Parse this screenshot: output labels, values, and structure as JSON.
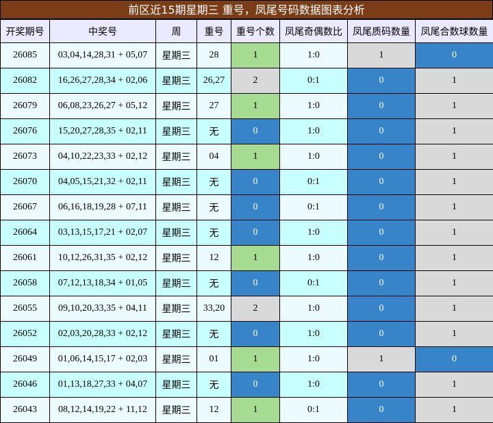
{
  "title": "前区近15期星期三 重号，凤尾号码数据图表分析",
  "headers": [
    "开奖期号",
    "中奖号",
    "周",
    "重号",
    "重号个数",
    "凤尾奇偶数比",
    "凤尾质码数量",
    "凤尾合数球数量"
  ],
  "colors": {
    "title_bg": "#7a3d16",
    "header_bg": "#eaeaff",
    "row_odd": "#ebfbff",
    "row_even": "#c8ffff",
    "green": "#a6dc92",
    "blue": "#3784c8",
    "gray": "#d9d9d9"
  },
  "rows": [
    {
      "issue": "26085",
      "numbers": "03,04,14,28,31 + 05,07",
      "week": "星期三",
      "repeat": "28",
      "repeat_count": "1",
      "ratio": "1:0",
      "prime": "1",
      "composite": "0"
    },
    {
      "issue": "26082",
      "numbers": "16,26,27,28,34 + 02,06",
      "week": "星期三",
      "repeat": "26,27",
      "repeat_count": "2",
      "ratio": "0:1",
      "prime": "0",
      "composite": "1"
    },
    {
      "issue": "26079",
      "numbers": "06,08,23,26,27 + 05,12",
      "week": "星期三",
      "repeat": "27",
      "repeat_count": "1",
      "ratio": "1:0",
      "prime": "0",
      "composite": "1"
    },
    {
      "issue": "26076",
      "numbers": "15,20,27,28,35 + 02,11",
      "week": "星期三",
      "repeat": "无",
      "repeat_count": "0",
      "ratio": "1:0",
      "prime": "0",
      "composite": "1"
    },
    {
      "issue": "26073",
      "numbers": "04,10,22,23,33 + 02,12",
      "week": "星期三",
      "repeat": "04",
      "repeat_count": "1",
      "ratio": "1:0",
      "prime": "0",
      "composite": "1"
    },
    {
      "issue": "26070",
      "numbers": "04,05,15,21,32 + 02,11",
      "week": "星期三",
      "repeat": "无",
      "repeat_count": "0",
      "ratio": "0:1",
      "prime": "0",
      "composite": "1"
    },
    {
      "issue": "26067",
      "numbers": "06,16,18,19,28 + 07,11",
      "week": "星期三",
      "repeat": "无",
      "repeat_count": "0",
      "ratio": "0:1",
      "prime": "0",
      "composite": "1"
    },
    {
      "issue": "26064",
      "numbers": "03,13,15,17,21 + 02,07",
      "week": "星期三",
      "repeat": "无",
      "repeat_count": "0",
      "ratio": "1:0",
      "prime": "0",
      "composite": "1"
    },
    {
      "issue": "26061",
      "numbers": "10,12,26,31,35 + 02,12",
      "week": "星期三",
      "repeat": "12",
      "repeat_count": "1",
      "ratio": "1:0",
      "prime": "0",
      "composite": "1"
    },
    {
      "issue": "26058",
      "numbers": "07,12,13,18,34 + 01,05",
      "week": "星期三",
      "repeat": "无",
      "repeat_count": "0",
      "ratio": "0:1",
      "prime": "0",
      "composite": "1"
    },
    {
      "issue": "26055",
      "numbers": "09,10,20,33,35 + 04,11",
      "week": "星期三",
      "repeat": "33,20",
      "repeat_count": "2",
      "ratio": "1:0",
      "prime": "0",
      "composite": "1"
    },
    {
      "issue": "26052",
      "numbers": "02,03,20,28,33 + 02,12",
      "week": "星期三",
      "repeat": "无",
      "repeat_count": "0",
      "ratio": "1:0",
      "prime": "0",
      "composite": "1"
    },
    {
      "issue": "26049",
      "numbers": "01,06,14,15,17 + 02,03",
      "week": "星期三",
      "repeat": "01",
      "repeat_count": "1",
      "ratio": "1:0",
      "prime": "1",
      "composite": "0"
    },
    {
      "issue": "26046",
      "numbers": "01,13,18,27,33 + 04,07",
      "week": "星期三",
      "repeat": "无",
      "repeat_count": "0",
      "ratio": "1:0",
      "prime": "0",
      "composite": "1"
    },
    {
      "issue": "26043",
      "numbers": "08,12,14,19,22 + 11,12",
      "week": "星期三",
      "repeat": "12",
      "repeat_count": "1",
      "ratio": "0:1",
      "prime": "0",
      "composite": "1"
    }
  ]
}
